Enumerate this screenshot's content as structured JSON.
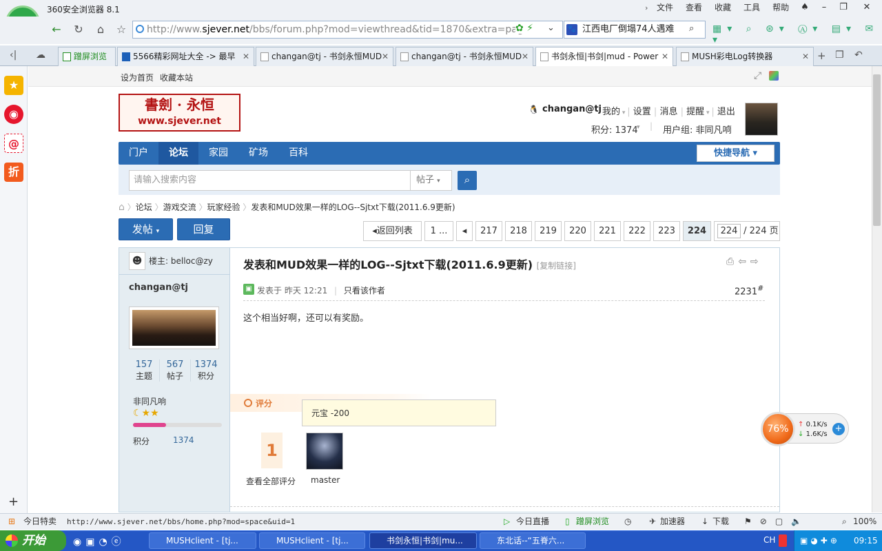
{
  "browser": {
    "app_title": "360安全浏览器 8.1",
    "menus": [
      "文件",
      "查看",
      "收藏",
      "工具",
      "帮助"
    ],
    "address_prefix": "http://www.",
    "address_host": "sjever.net",
    "address_rest": "/bbs/forum.php?mod=viewthread&tid=1870&extra=page%",
    "search_text": "江西电厂倒塌74人遇难",
    "tabs": [
      {
        "label": "蹭屏浏览",
        "active": false
      },
      {
        "label": "5566精彩网址大全 -> 最早",
        "active": false
      },
      {
        "label": "changan@tj - 书剑永恒MUD",
        "active": false
      },
      {
        "label": "changan@tj - 书剑永恒MUD",
        "active": false
      },
      {
        "label": "书剑永恒|书剑|mud - Power",
        "active": true
      },
      {
        "label": "MUSH彩电Log转换器",
        "active": false
      }
    ]
  },
  "site": {
    "top_links": [
      "设为首页",
      "收藏本站"
    ],
    "logo_title": "書劍 · 永恒",
    "logo_url": "www.sjever.net",
    "user": {
      "name": "changan@tj",
      "links": [
        "我的",
        "设置",
        "消息",
        "提醒",
        "退出"
      ],
      "points_label": "积分: 1374",
      "group_label": "用户组: 非同凡响"
    },
    "nav": [
      "门户",
      "论坛",
      "家园",
      "矿场",
      "百科"
    ],
    "quick_nav": "快捷导航",
    "search_placeholder": "请输入搜索内容",
    "search_type": "帖子",
    "breadcrumb": [
      "论坛",
      "游戏交流",
      "玩家经验",
      "发表和MUD效果一样的LOG--Sjtxt下载(2011.6.9更新)"
    ]
  },
  "actions": {
    "post": "发帖",
    "reply": "回复"
  },
  "pager": {
    "back": "返回列表",
    "first": "1 ...",
    "pages": [
      "217",
      "218",
      "219",
      "220",
      "221",
      "222",
      "223",
      "224"
    ],
    "current": "224",
    "total": "/ 224 页"
  },
  "thread": {
    "starter_label": "楼主:",
    "starter": "belloc@zy",
    "title": "发表和MUD效果一样的LOG--Sjtxt下载(2011.6.9更新)",
    "copy_link": "[复制链接]"
  },
  "post": {
    "author": "changan@tj",
    "stats": [
      {
        "value": "157",
        "label": "主题"
      },
      {
        "value": "567",
        "label": "帖子"
      },
      {
        "value": "1374",
        "label": "积分"
      }
    ],
    "rank": "非同凡响",
    "points_label": "积分",
    "points": "1374",
    "points_progress": 0.37,
    "posted_at": "发表于 昨天 12:21",
    "only_author": "只看该作者",
    "floor": "2231",
    "floor_mark": "#",
    "content": "这个相当好啊，还可以有奖励。",
    "rate_label": "评分",
    "rate_count": "1",
    "view_all": "查看全部评分",
    "rater": "master",
    "tooltip": "元宝 -200"
  },
  "netwidget": {
    "percent": "76%",
    "up": "0.1K/s",
    "down": "1.6K/s"
  },
  "statusbar": {
    "today": "今日特卖",
    "url": "http://www.sjever.net/bbs/home.php?mod=space&uid=1",
    "items": [
      "今日直播",
      "蹭屏浏览",
      "加速器",
      "下载"
    ],
    "zoom": "100%"
  },
  "taskbar": {
    "start": "开始",
    "windows": [
      {
        "label": "MUSHclient - [tj...",
        "active": false
      },
      {
        "label": "MUSHclient - [tj...",
        "active": false
      },
      {
        "label": "书剑永恒|书剑|mu...",
        "active": true
      },
      {
        "label": "东北话--“五脊六...",
        "active": false
      }
    ],
    "lang": "CH",
    "time": "09:15"
  }
}
